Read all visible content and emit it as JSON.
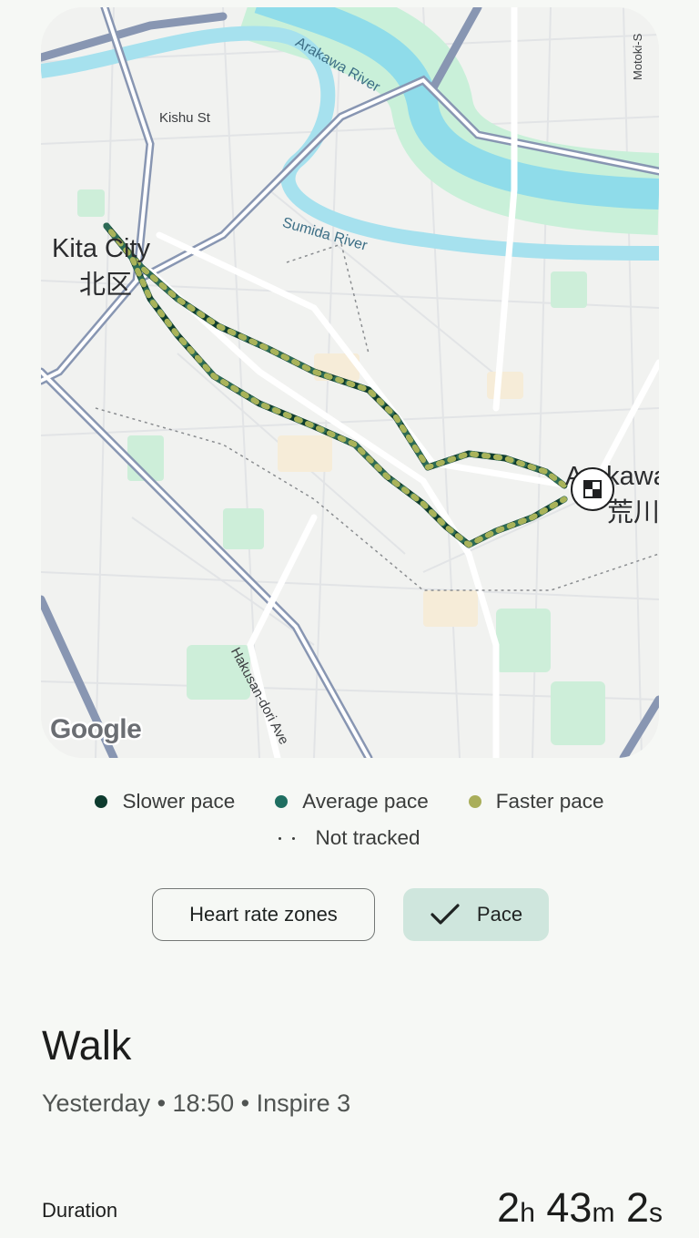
{
  "map": {
    "labels": {
      "arakawa_river": "Arakawa River",
      "sumida_river": "Sumida River",
      "kishu_st": "Kishu St",
      "motoki": "Motoki-S",
      "kita_city_en": "Kita City",
      "kita_city_jp": "北区",
      "arakawa_partial_en": "Arakawa",
      "arakawa_partial_jp": "荒川",
      "hakusan": "Hakusan-dori Ave"
    },
    "attribution": "Google",
    "route_colors": {
      "slower": "#0f3d2f",
      "average": "#2c6a55",
      "faster": "#a9b35a"
    }
  },
  "legend": {
    "slower": "Slower pace",
    "average": "Average pace",
    "faster": "Faster pace",
    "not_tracked": "Not tracked",
    "colors": {
      "slower": "#0e3b2e",
      "average": "#1f6e61",
      "faster": "#a9ae5a"
    }
  },
  "toggle": {
    "heart_rate": "Heart rate zones",
    "pace": "Pace"
  },
  "activity": {
    "title": "Walk",
    "subtitle": "Yesterday • 18:50 • Inspire 3",
    "duration_label": "Duration",
    "duration": {
      "h": "2",
      "h_unit": "h",
      "m": "43",
      "m_unit": "m",
      "s": "2",
      "s_unit": "s"
    }
  }
}
